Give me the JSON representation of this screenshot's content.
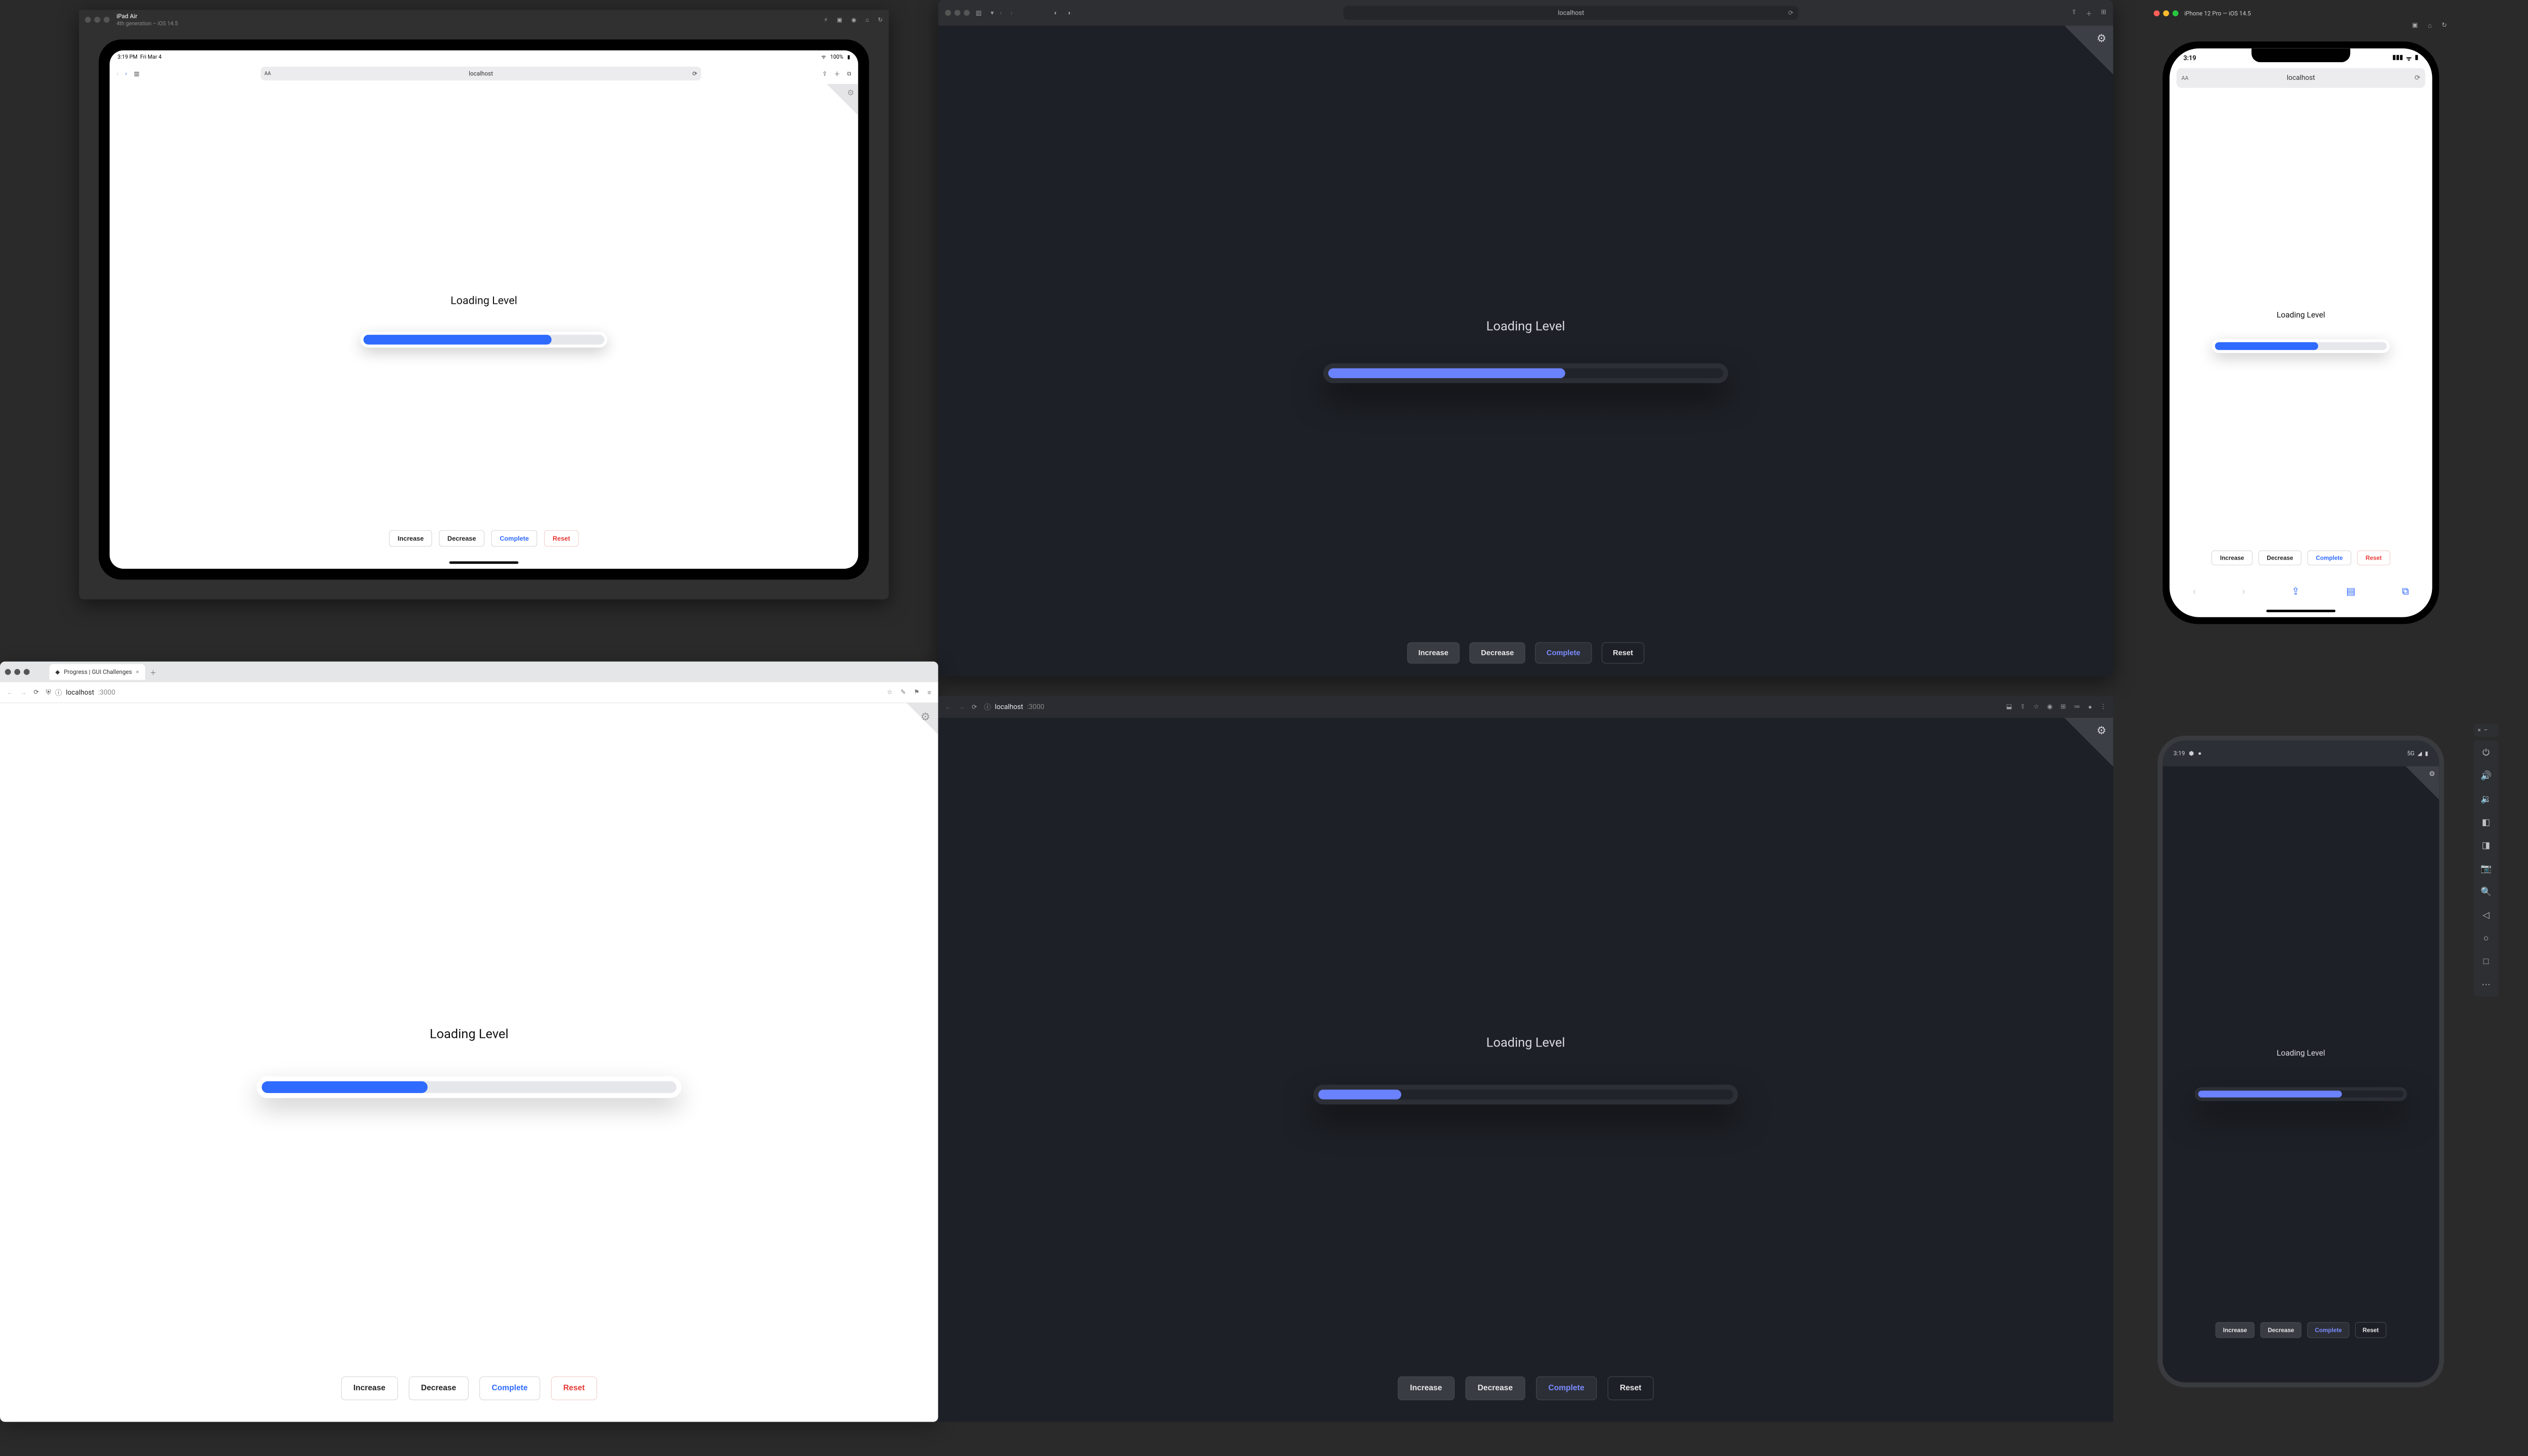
{
  "sim_ipad": {
    "title": "iPad Air",
    "subtitle": "4th generation – iOS 14.5",
    "status_time": "3:19 PM",
    "status_date": "Fri Mar 4",
    "status_charge": "100%",
    "url": "localhost",
    "aa": "AA"
  },
  "safari": {
    "url": "localhost"
  },
  "sim_iphone": {
    "title": "iPhone 12 Pro — iOS 14.5",
    "status_time": "3:19",
    "url": "localhost",
    "aa": "AA"
  },
  "chrome_light": {
    "tab_title": "Progress | GUI Challenges",
    "host": "localhost",
    "port": ":3000"
  },
  "chrome_dark": {
    "host": "localhost",
    "port": ":3000"
  },
  "android": {
    "time": "3:19"
  },
  "demo": {
    "label": "Loading Level",
    "btn_increase": "Increase",
    "btn_decrease": "Decrease",
    "btn_complete": "Complete",
    "btn_reset": "Reset"
  },
  "progress": {
    "ipad_pct": "78%",
    "safari_pct": "60%",
    "iphone_pct": "60%",
    "chrome_light_pct": "40%",
    "chrome_dark_pct": "20%",
    "android_pct": "70%"
  }
}
